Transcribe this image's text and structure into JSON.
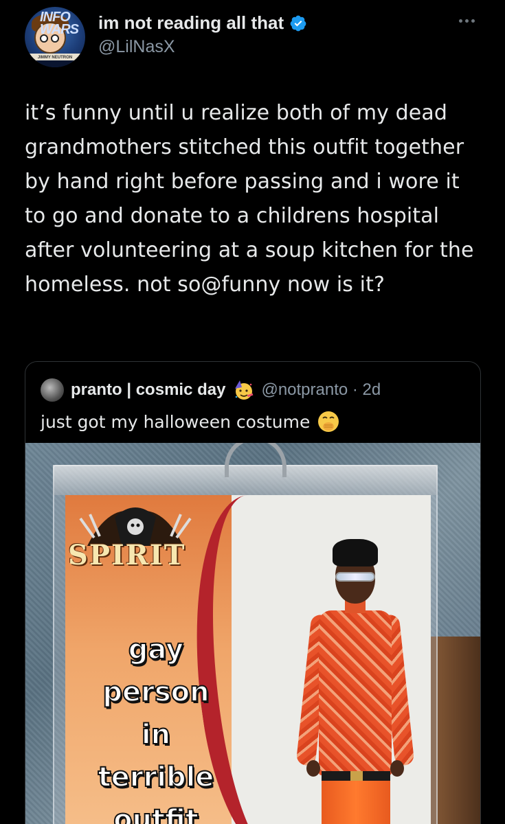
{
  "tweet": {
    "display_name": "im not reading all that",
    "handle": "@LilNasX",
    "text": "it’s funny until u realize both of my dead grandmothers stitched this outfit together by hand right before passing and i wore it to go and donate to a childrens hospital after volunteering at a soup kitchen for the homeless. not so@funny now is it?",
    "avatar_icon": "jimmy-neutron-avatar",
    "avatar_banner": "INFO WARS",
    "avatar_strip": "JIMMY NEUTRON",
    "verified_icon": "verified-badge-icon",
    "accent_color": "#1d9bf0"
  },
  "quote": {
    "display_name": "pranto | cosmic day",
    "name_emoji": "partying-face-emoji",
    "handle_time": "@notpranto · 2d",
    "text": "just got my halloween costume",
    "text_emoji": "face-with-hand-over-mouth-emoji",
    "image": {
      "brand_text": "SPIRIT",
      "costume_lines": [
        "gay",
        "person",
        "in",
        "terrible",
        "outfit"
      ]
    }
  }
}
